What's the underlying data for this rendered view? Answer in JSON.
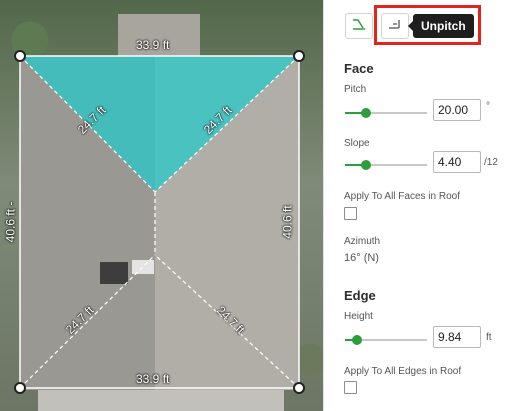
{
  "map": {
    "top_length": "33.9 ft",
    "bottom_length": "33.9 ft",
    "left_length": "40.6 ft -",
    "right_length": "40.6 ft",
    "hip_top_left": "24.7 ft",
    "hip_top_right": "24.7 ft",
    "hip_bottom_left": "24.7 ft",
    "hip_bottom_right": "24.7 ft",
    "selected_face_color": "#27c8c8",
    "edge_color": "#ffffff"
  },
  "toolbar": {
    "pitch_tool_icon": "pitch-face-icon",
    "unpitch_tool_icon": "unpitch-icon",
    "tooltip": "Unpitch",
    "highlight_color": "#e3241b"
  },
  "face": {
    "title": "Face",
    "pitch_label": "Pitch",
    "pitch_value": "20.00",
    "pitch_unit": "°",
    "pitch_fraction": 0.25,
    "slope_label": "Slope",
    "slope_value": "4.40",
    "slope_unit": "/12",
    "slope_fraction": 0.25,
    "apply_all_faces_label": "Apply To All Faces in Roof",
    "apply_all_faces_checked": false,
    "azimuth_label": "Azimuth",
    "azimuth_value": "16° (N)"
  },
  "edge": {
    "title": "Edge",
    "height_label": "Height",
    "height_value": "9.84",
    "height_unit": "ft",
    "height_fraction": 0.15,
    "apply_all_edges_label": "Apply To All Edges in Roof",
    "apply_all_edges_checked": false
  },
  "accent_color": "#2e9d3c"
}
